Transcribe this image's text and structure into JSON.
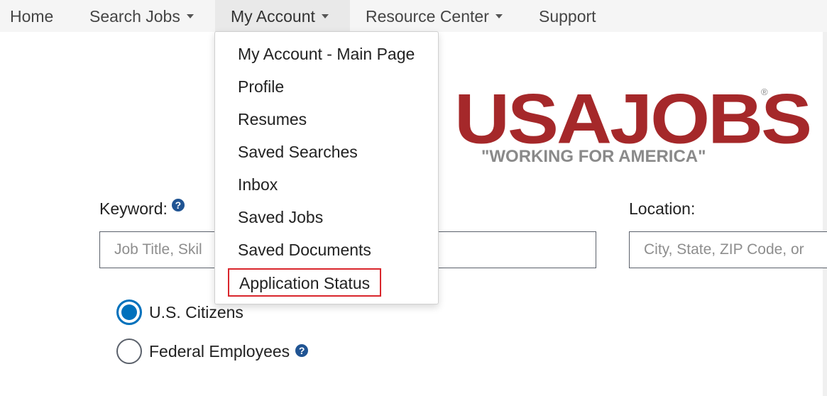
{
  "nav": {
    "home": "Home",
    "search_jobs": "Search Jobs",
    "my_account": "My Account",
    "resource_center": "Resource Center",
    "support": "Support"
  },
  "dropdown": {
    "items": [
      "My Account - Main Page",
      "Profile",
      "Resumes",
      "Saved Searches",
      "Inbox",
      "Saved Jobs",
      "Saved Documents",
      "Application Status"
    ],
    "highlighted": "Application Status"
  },
  "logo": {
    "text": "USAJOBS",
    "tagline": "\"WORKING FOR AMERICA\"",
    "registered": "®"
  },
  "search": {
    "keyword_label": "Keyword:",
    "keyword_placeholder": "Job Title, Skil",
    "location_label": "Location:",
    "location_placeholder": "City, State, ZIP Code, or"
  },
  "audience": {
    "options": [
      "U.S. Citizens",
      "Federal Employees"
    ],
    "selected": "U.S. Citizens"
  },
  "colors": {
    "logo_red": "#a5282a",
    "highlight_red": "#d9262c",
    "accent_blue": "#0071bc",
    "help_blue": "#205493"
  }
}
